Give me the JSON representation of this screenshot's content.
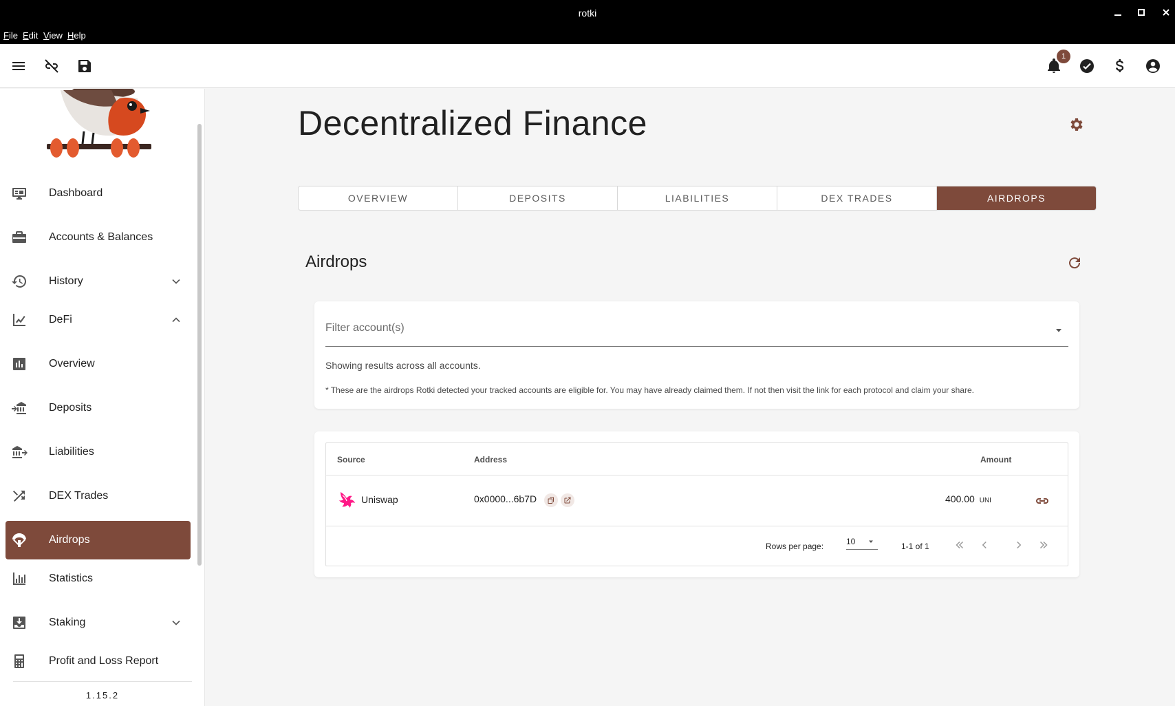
{
  "window": {
    "title": "rotki",
    "minimize": "–",
    "maximize": "□",
    "close": "✕"
  },
  "menu": {
    "items": [
      {
        "label": "File",
        "accel": "F"
      },
      {
        "label": "Edit",
        "accel": "E"
      },
      {
        "label": "View",
        "accel": "V"
      },
      {
        "label": "Help",
        "accel": "H"
      }
    ]
  },
  "appbar": {
    "notifications_count": "1",
    "icons": [
      "menu-icon",
      "link-off-icon",
      "save-icon",
      "bell-icon",
      "check-circle-icon",
      "dollar-icon",
      "account-circle-icon"
    ]
  },
  "sidebar": {
    "items": [
      {
        "label": "Dashboard",
        "icon": "monitor-dashboard-icon"
      },
      {
        "label": "Accounts & Balances",
        "icon": "briefcase-icon"
      },
      {
        "label": "History",
        "icon": "history-icon",
        "expand": "down"
      },
      {
        "label": "DeFi",
        "icon": "chart-line-icon",
        "expand": "up"
      },
      {
        "label": "Overview",
        "icon": "chart-box-icon"
      },
      {
        "label": "Deposits",
        "icon": "bank-transfer-in-icon"
      },
      {
        "label": "Liabilities",
        "icon": "bank-transfer-out-icon"
      },
      {
        "label": "DEX Trades",
        "icon": "shuffle-icon"
      },
      {
        "label": "Airdrops",
        "icon": "parachute-icon",
        "active": true
      },
      {
        "label": "Statistics",
        "icon": "bar-chart-icon"
      },
      {
        "label": "Staking",
        "icon": "inbox-arrow-down-icon",
        "expand": "down"
      },
      {
        "label": "Profit and Loss Report",
        "icon": "calculator-icon"
      }
    ],
    "version": "1.15.2"
  },
  "main": {
    "page_title": "Decentralized Finance",
    "tabs": [
      {
        "label": "OVERVIEW"
      },
      {
        "label": "DEPOSITS"
      },
      {
        "label": "LIABILITIES"
      },
      {
        "label": "DEX TRADES"
      },
      {
        "label": "AIRDROPS",
        "active": true
      }
    ],
    "section_title": "Airdrops",
    "filter": {
      "label": "Filter account(s)",
      "showing": "Showing results across all accounts.",
      "note": "* These are the airdrops Rotki detected your tracked accounts are eligible for. You may have already claimed them. If not then visit the link for each protocol and claim your share."
    },
    "table": {
      "headers": {
        "source": "Source",
        "address": "Address",
        "amount": "Amount"
      },
      "rows": [
        {
          "source": "Uniswap",
          "address": "0x0000...6b7D",
          "amount": "400.00",
          "unit": "UNI"
        }
      ],
      "footer": {
        "rows_per_page_label": "Rows per page:",
        "rows_per_page_value": "10",
        "range": "1-1 of 1"
      }
    }
  },
  "colors": {
    "accent": "#7e4a3b",
    "titlebar": "#000000",
    "uniswap_pink": "#ff007a"
  }
}
